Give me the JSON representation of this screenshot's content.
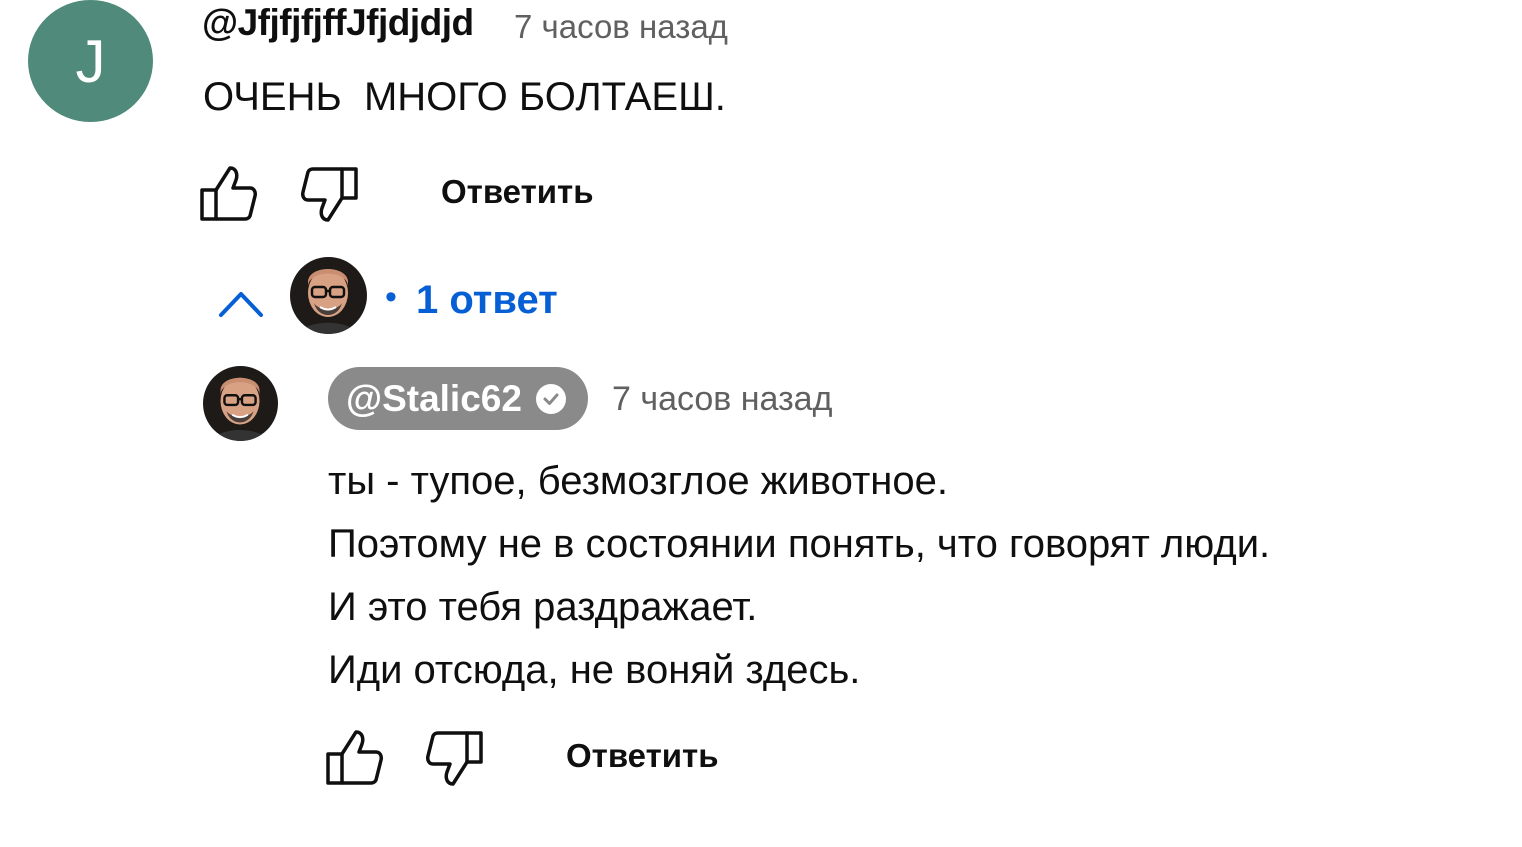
{
  "comment": {
    "avatar_letter": "J",
    "avatar_color": "#4f8a7a",
    "author": "@JfjfjfjffJfjdjdjd",
    "time": "7 часов назад",
    "text": "ОЧЕНЬ  МНОГО БОЛТАЕШ.",
    "actions": {
      "like_icon": "thumb-up-icon",
      "dislike_icon": "thumb-down-icon",
      "reply_label": "Ответить"
    }
  },
  "replies_toggle": {
    "icon": "chevron-up-icon",
    "dot": "•",
    "count_label": "1 ответ",
    "link_color": "#065fd4"
  },
  "reply": {
    "author": "@Stalic62",
    "verified_icon": "verified-check-icon",
    "time": "7 часов назад",
    "lines": [
      "ты - тупое, безмозглое животное.",
      "Поэтому не в состоянии понять, что говорят люди.",
      "И это тебя раздражает.",
      "Иди отсюда, не воняй здесь."
    ],
    "actions": {
      "like_icon": "thumb-up-icon",
      "dislike_icon": "thumb-down-icon",
      "reply_label": "Ответить"
    }
  }
}
